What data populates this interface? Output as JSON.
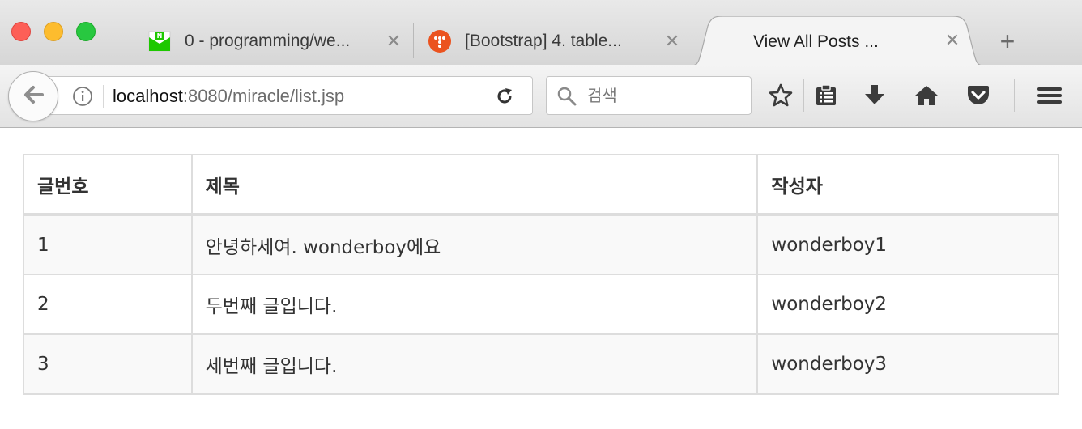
{
  "browser": {
    "tabs": [
      {
        "title": "0 - programming/we...",
        "favicon": "naver-mail-icon",
        "active": false
      },
      {
        "title": "[Bootstrap] 4. table...",
        "favicon": "tistory-icon",
        "active": false
      },
      {
        "title": "View All Posts ...",
        "favicon": "",
        "active": true
      }
    ],
    "new_tab_label": "+",
    "close_label": "✕",
    "url": {
      "host": "localhost",
      "rest": ":8080/miracle/list.jsp"
    },
    "search": {
      "placeholder": "검색"
    },
    "toolbar_icons": [
      "star-icon",
      "reading-list-icon",
      "download-icon",
      "home-icon",
      "pocket-icon",
      "menu-icon"
    ]
  },
  "table": {
    "headers": {
      "num": "글번호",
      "title": "제목",
      "author": "작성자"
    },
    "rows": [
      {
        "num": "1",
        "title": "안녕하세여. wonderboy에요",
        "author": "wonderboy1"
      },
      {
        "num": "2",
        "title": "두번째 글입니다.",
        "author": "wonderboy2"
      },
      {
        "num": "3",
        "title": "세번째 글입니다.",
        "author": "wonderboy3"
      }
    ]
  },
  "colors": {
    "traffic_red": "#fd5f57",
    "traffic_yellow": "#fdbc2e",
    "traffic_green": "#28c840",
    "table_border": "#dddddd",
    "stripe": "#f9f9f9"
  }
}
